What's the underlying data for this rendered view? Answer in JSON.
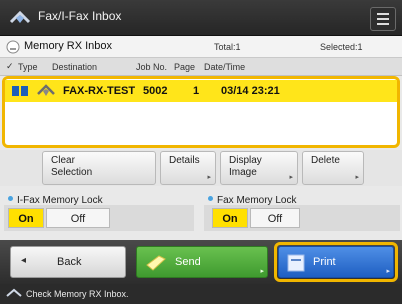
{
  "header": {
    "title": "Fax/I-Fax Inbox"
  },
  "inbox": {
    "name": "Memory RX Inbox",
    "total": "Total:1",
    "selected": "Selected:1"
  },
  "columns": [
    "Type",
    "Destination",
    "Job No.",
    "Page",
    "Date/Time"
  ],
  "rows": [
    {
      "destination": "FAX-RX-TEST",
      "job_no": "5002",
      "page": "1",
      "datetime": "03/14 23:21"
    }
  ],
  "actions": {
    "clear_selection": "Clear\nSelection",
    "details": "Details",
    "display_image": "Display\nImage",
    "delete": "Delete"
  },
  "locks": {
    "ifax_label": "I-Fax Memory Lock",
    "fax_label": "Fax Memory Lock",
    "on": "On",
    "off": "Off"
  },
  "nav": {
    "back": "Back",
    "send": "Send",
    "print": "Print"
  },
  "status": {
    "message": "Check Memory RX Inbox."
  },
  "colors": {
    "highlight": "#ffe51a",
    "accent": "#f1b600",
    "print_blue": "#2f6fd0",
    "send_green": "#4aa23a"
  }
}
